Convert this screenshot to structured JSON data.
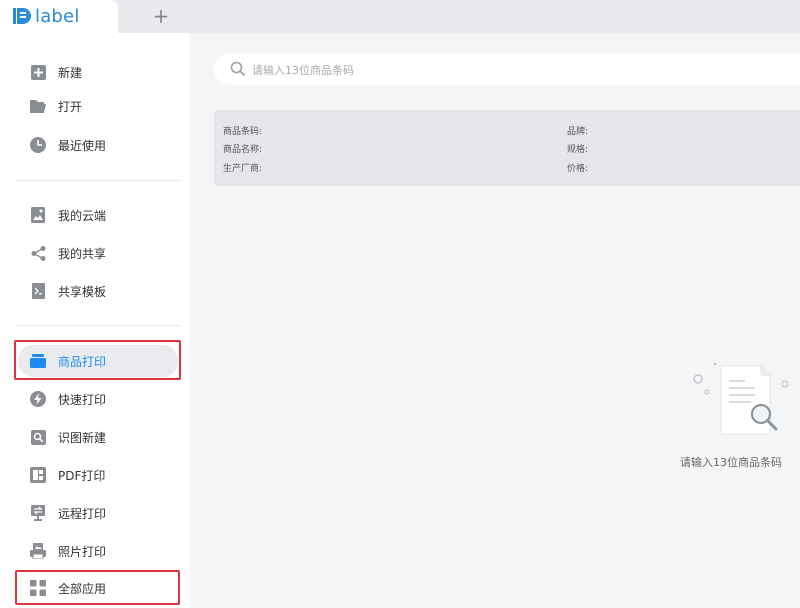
{
  "app": {
    "logo_text": "label",
    "new_tab_symbol": "+"
  },
  "sidebar": {
    "items": [
      {
        "label": "新建",
        "icon": "plus-square-icon"
      },
      {
        "label": "打开",
        "icon": "folder-open-icon"
      },
      {
        "label": "最近使用",
        "icon": "clock-icon"
      },
      {
        "label": "我的云端",
        "icon": "cloud-image-icon"
      },
      {
        "label": "我的共享",
        "icon": "share-icon"
      },
      {
        "label": "共享模板",
        "icon": "template-icon"
      },
      {
        "label": "商品打印",
        "icon": "box-stack-icon"
      },
      {
        "label": "快速打印",
        "icon": "lightning-icon"
      },
      {
        "label": "识图新建",
        "icon": "image-search-icon"
      },
      {
        "label": "PDF打印",
        "icon": "pdf-icon"
      },
      {
        "label": "远程打印",
        "icon": "remote-print-icon"
      },
      {
        "label": "照片打印",
        "icon": "photo-print-icon"
      },
      {
        "label": "全部应用",
        "icon": "grid-apps-icon"
      }
    ],
    "active_label": "商品打印",
    "active_color": "#1d8cf0"
  },
  "search": {
    "placeholder": "请输入13位商品条码"
  },
  "product_info": {
    "barcode_label": "商品条码:",
    "name_label": "商品名称:",
    "manufacturer_label": "生产厂商:",
    "brand_label": "品牌:",
    "spec_label": "规格:",
    "price_label": "价格:"
  },
  "empty_state": {
    "message": "请输入13位商品条码"
  },
  "colors": {
    "accent": "#1d8cf0",
    "highlight": "#d9363e",
    "logo": "#2a8bd6"
  }
}
